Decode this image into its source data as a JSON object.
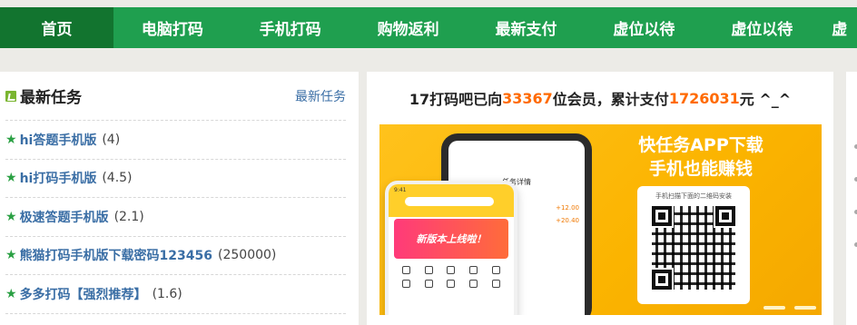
{
  "nav": {
    "items": [
      {
        "label": "首页",
        "active": true
      },
      {
        "label": "电脑打码"
      },
      {
        "label": "手机打码"
      },
      {
        "label": "购物返利"
      },
      {
        "label": "最新支付"
      },
      {
        "label": "虚位以待"
      },
      {
        "label": "虚位以待"
      }
    ],
    "partial_label": "虚",
    "bg_color": "#1f9f4f",
    "active_color": "#12742f"
  },
  "tasks_panel": {
    "title": "最新任务",
    "more_link": "最新任务",
    "items": [
      {
        "name": "hi答题手机版",
        "score": "(4)"
      },
      {
        "name": "hi打码手机版",
        "score": "(4.5)"
      },
      {
        "name": "极速答题手机版",
        "score": "(2.1)"
      },
      {
        "name": "熊猫打码手机版下载密码123456",
        "score": "(250000)"
      },
      {
        "name": "多多打码【强烈推荐】",
        "score": "(1.6)"
      }
    ]
  },
  "stats": {
    "prefix": "17打码吧已向",
    "members": "33367",
    "members_suffix": "位会员，累计支付",
    "total_paid": "1726031",
    "paid_suffix": "元 ^_^",
    "highlight_color": "#ff6a00"
  },
  "banner": {
    "headline_line1": "快任务APP下载",
    "headline_line2": "手机也能赚钱",
    "qr_caption": "手机扫描下面的二维码安装",
    "phone_title": "任务详情",
    "coin_1": "+12.00",
    "coin_2": "+20.40",
    "promo_text": "新版本上线啦！",
    "bg_color": "#fbb400"
  }
}
